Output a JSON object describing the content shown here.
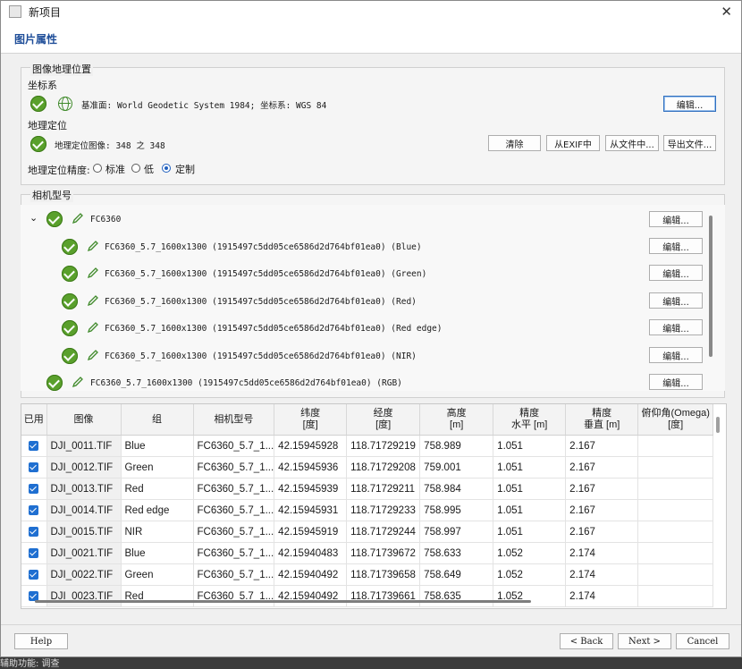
{
  "window": {
    "title": "新项目",
    "close": "✕"
  },
  "page_title": "图片属性",
  "geo": {
    "group_label": "图像地理位置",
    "crs_label": "坐标系",
    "crs_text": "基准面: World Geodetic System 1984; 坐标系: WGS 84",
    "edit_label": "编辑...",
    "geoloc_label": "地理定位",
    "geoloc_text": "地理定位图像: 348 之 348",
    "btn_clear": "清除",
    "btn_exif": "从EXIF中",
    "btn_file": "从文件中...",
    "btn_export": "导出文件...",
    "accuracy_label": "地理定位精度:",
    "accuracy_options": [
      "标准",
      "低",
      "定制"
    ],
    "accuracy_selected": "定制"
  },
  "camera": {
    "group_label": "相机型号",
    "root": "FC6360",
    "children": [
      "FC6360_5.7_1600x1300 (1915497c5dd05ce6586d2d764bf01ea0) (Blue)",
      "FC6360_5.7_1600x1300 (1915497c5dd05ce6586d2d764bf01ea0) (Green)",
      "FC6360_5.7_1600x1300 (1915497c5dd05ce6586d2d764bf01ea0) (Red)",
      "FC6360_5.7_1600x1300 (1915497c5dd05ce6586d2d764bf01ea0) (Red edge)",
      "FC6360_5.7_1600x1300 (1915497c5dd05ce6586d2d764bf01ea0) (NIR)"
    ],
    "rgb": "FC6360_5.7_1600x1300 (1915497c5dd05ce6586d2d764bf01ea0) (RGB)",
    "edit_label": "编辑..."
  },
  "table": {
    "headers": [
      "已用",
      "图像",
      "组",
      "相机型号",
      "纬度\n[度]",
      "经度\n[度]",
      "高度\n[m]",
      "精度\n水平 [m]",
      "精度\n垂直 [m]",
      "俯仰角(Omega)\n[度]"
    ],
    "rows": [
      [
        "DJI_0011.TIF",
        "Blue",
        "FC6360_5.7_1...",
        "42.15945928",
        "118.71729219",
        "758.989",
        "1.051",
        "2.167",
        ""
      ],
      [
        "DJI_0012.TIF",
        "Green",
        "FC6360_5.7_1...",
        "42.15945936",
        "118.71729208",
        "759.001",
        "1.051",
        "2.167",
        ""
      ],
      [
        "DJI_0013.TIF",
        "Red",
        "FC6360_5.7_1...",
        "42.15945939",
        "118.71729211",
        "758.984",
        "1.051",
        "2.167",
        ""
      ],
      [
        "DJI_0014.TIF",
        "Red edge",
        "FC6360_5.7_1...",
        "42.15945931",
        "118.71729233",
        "758.995",
        "1.051",
        "2.167",
        ""
      ],
      [
        "DJI_0015.TIF",
        "NIR",
        "FC6360_5.7_1...",
        "42.15945919",
        "118.71729244",
        "758.997",
        "1.051",
        "2.167",
        ""
      ],
      [
        "DJI_0021.TIF",
        "Blue",
        "FC6360_5.7_1...",
        "42.15940483",
        "118.71739672",
        "758.633",
        "1.052",
        "2.174",
        ""
      ],
      [
        "DJI_0022.TIF",
        "Green",
        "FC6360_5.7_1...",
        "42.15940492",
        "118.71739658",
        "758.649",
        "1.052",
        "2.174",
        ""
      ],
      [
        "DJI_0023.TIF",
        "Red",
        "FC6360_5.7_1...",
        "42.15940492",
        "118.71739661",
        "758.635",
        "1.052",
        "2.174",
        ""
      ]
    ]
  },
  "footer": {
    "help": "Help",
    "back": "< Back",
    "next": "Next >",
    "cancel": "Cancel"
  },
  "taskbar_fragment": "辅助功能: 调查",
  "colors": {
    "accent": "#1f4e99",
    "check": "#5aa02c",
    "checkbox": "#1f6fd1"
  }
}
